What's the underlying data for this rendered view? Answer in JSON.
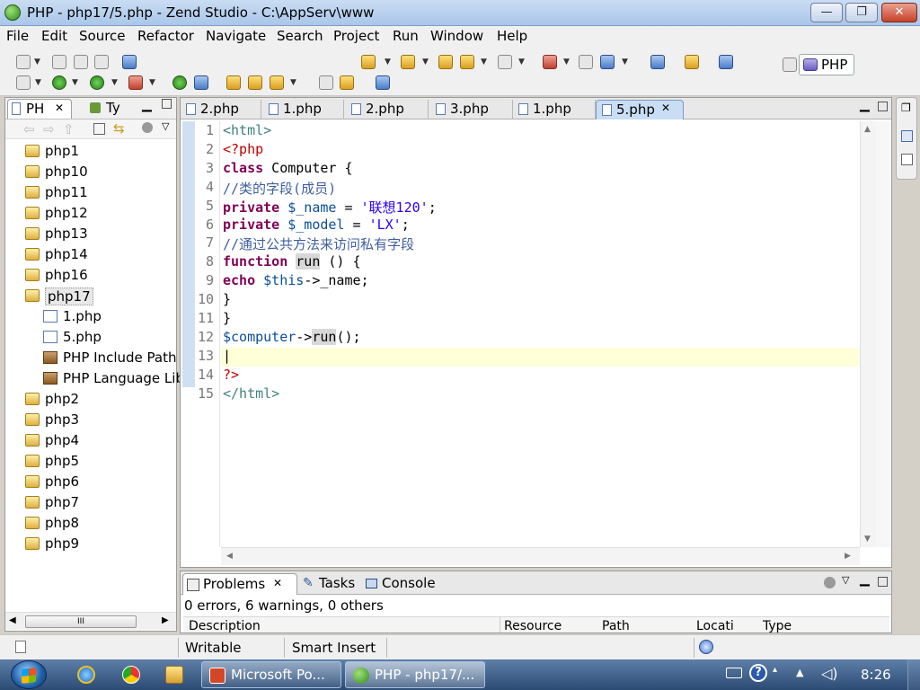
{
  "window": {
    "title": "PHP - php17/5.php - Zend Studio - C:\\AppServ\\www",
    "min_label": "—",
    "max_label": "❐",
    "close_label": "✕"
  },
  "menu": [
    "File",
    "Edit",
    "Source",
    "Refactor",
    "Navigate",
    "Search",
    "Project",
    "Run",
    "Window",
    "Help"
  ],
  "perspective": {
    "label": "PHP"
  },
  "explorer": {
    "tabs": [
      {
        "label": "PH",
        "close": "✕"
      },
      {
        "label": "Ty"
      }
    ],
    "items": [
      {
        "label": "php1",
        "type": "project",
        "indent": 0
      },
      {
        "label": "php10",
        "type": "project",
        "indent": 0
      },
      {
        "label": "php11",
        "type": "project",
        "indent": 0
      },
      {
        "label": "php12",
        "type": "project",
        "indent": 0
      },
      {
        "label": "php13",
        "type": "project",
        "indent": 0
      },
      {
        "label": "php14",
        "type": "project",
        "indent": 0
      },
      {
        "label": "php16",
        "type": "project",
        "indent": 0
      },
      {
        "label": "php17",
        "type": "project",
        "indent": 0,
        "selected": true
      },
      {
        "label": "1.php",
        "type": "file",
        "indent": 1
      },
      {
        "label": "5.php",
        "type": "file",
        "indent": 1
      },
      {
        "label": "PHP Include Path",
        "type": "lib",
        "indent": 1
      },
      {
        "label": "PHP Language Lib",
        "type": "lib",
        "indent": 1
      },
      {
        "label": "php2",
        "type": "project",
        "indent": 0
      },
      {
        "label": "php3",
        "type": "project",
        "indent": 0
      },
      {
        "label": "php4",
        "type": "project",
        "indent": 0
      },
      {
        "label": "php5",
        "type": "project",
        "indent": 0
      },
      {
        "label": "php6",
        "type": "project",
        "indent": 0
      },
      {
        "label": "php7",
        "type": "project",
        "indent": 0
      },
      {
        "label": "php8",
        "type": "project",
        "indent": 0
      },
      {
        "label": "php9",
        "type": "project",
        "indent": 0
      }
    ],
    "scroll_thumb": "III"
  },
  "editor": {
    "tabs": [
      {
        "label": "2.php"
      },
      {
        "label": "1.php"
      },
      {
        "label": "2.php"
      },
      {
        "label": "3.php"
      },
      {
        "label": "1.php"
      },
      {
        "label": "5.php",
        "active": true,
        "close": "✕"
      }
    ],
    "line_numbers": [
      "1",
      "2",
      "3",
      "4",
      "5",
      "6",
      "7",
      "8",
      "9",
      "10",
      "11",
      "12",
      "13",
      "14",
      "15"
    ],
    "lines": [
      [
        {
          "t": "<html>",
          "c": "tag"
        }
      ],
      [
        {
          "t": "<?php",
          "c": "php-tag"
        }
      ],
      [
        {
          "t": "class",
          "c": "kw"
        },
        {
          "t": " Computer {",
          "c": ""
        }
      ],
      [
        {
          "t": "//类的字段(成员)",
          "c": "cmt"
        }
      ],
      [
        {
          "t": "private",
          "c": "kw"
        },
        {
          "t": " ",
          "c": ""
        },
        {
          "t": "$_name",
          "c": "var"
        },
        {
          "t": " = ",
          "c": ""
        },
        {
          "t": "'联想120'",
          "c": "str"
        },
        {
          "t": ";",
          "c": ""
        }
      ],
      [
        {
          "t": "private",
          "c": "kw"
        },
        {
          "t": " ",
          "c": ""
        },
        {
          "t": "$_model",
          "c": "var"
        },
        {
          "t": " = ",
          "c": ""
        },
        {
          "t": "'LX'",
          "c": "str"
        },
        {
          "t": ";",
          "c": ""
        }
      ],
      [
        {
          "t": "//通过公共方法来访问私有字段",
          "c": "cmt"
        }
      ],
      [
        {
          "t": "function",
          "c": "kw"
        },
        {
          "t": " ",
          "c": ""
        },
        {
          "t": "run",
          "c": "hl"
        },
        {
          "t": " () {",
          "c": ""
        }
      ],
      [
        {
          "t": "echo",
          "c": "kw"
        },
        {
          "t": " ",
          "c": ""
        },
        {
          "t": "$this",
          "c": "var"
        },
        {
          "t": "->_name;",
          "c": ""
        }
      ],
      [
        {
          "t": "}",
          "c": ""
        }
      ],
      [
        {
          "t": "}",
          "c": ""
        }
      ],
      [
        {
          "t": "$computer",
          "c": "var"
        },
        {
          "t": "->",
          "c": ""
        },
        {
          "t": "run",
          "c": "hl"
        },
        {
          "t": "();",
          "c": ""
        }
      ],
      [
        {
          "t": "|",
          "c": ""
        }
      ],
      [
        {
          "t": "?>",
          "c": "php-tag"
        }
      ],
      [
        {
          "t": "</html>",
          "c": "tag"
        }
      ]
    ]
  },
  "problems": {
    "tabs": [
      {
        "label": "Problems",
        "close": "✕"
      },
      {
        "label": "Tasks"
      },
      {
        "label": "Console"
      }
    ],
    "summary": "0 errors, 6 warnings, 0 others",
    "columns": [
      "Description",
      "Resource",
      "Path",
      "Locati",
      "Type"
    ]
  },
  "status": {
    "mode": "Writable",
    "insert": "Smart Insert"
  },
  "taskbar": {
    "buttons": [
      {
        "label": "Microsoft Po..."
      },
      {
        "label": "PHP - php17/..."
      }
    ],
    "clock": "8:26"
  },
  "colors": {
    "keyword": "#7f0055",
    "string": "#2a00ff",
    "comment": "#3f5f9f",
    "tag": "#3f7f7f",
    "current_line": "#ffffd8"
  }
}
